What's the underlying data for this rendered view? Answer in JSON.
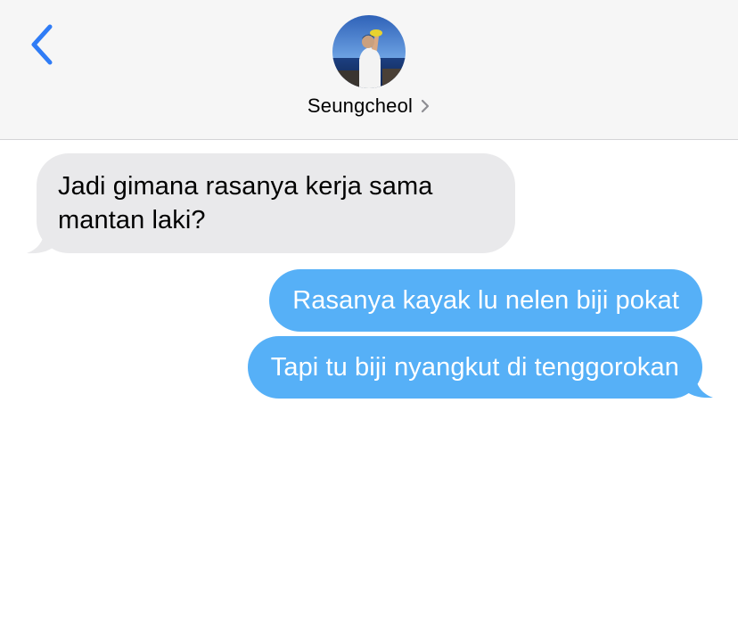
{
  "header": {
    "back_icon": "chevron-left-icon",
    "contact_name": "Seungcheol",
    "contact_chevron_icon": "chevron-right-icon",
    "accent_color": "#2f7cf6"
  },
  "messages": [
    {
      "direction": "incoming",
      "text_lines": [
        "Jadi gimana rasanya kerja sama",
        "mantan laki?"
      ]
    },
    {
      "direction": "outgoing",
      "text": "Rasanya kayak lu nelen biji pokat"
    },
    {
      "direction": "outgoing",
      "text": "Tapi tu biji nyangkut di tenggorokan"
    }
  ],
  "colors": {
    "incoming_bubble": "#e9e9eb",
    "outgoing_bubble": "#56b0f7",
    "header_background": "#f6f6f6"
  }
}
